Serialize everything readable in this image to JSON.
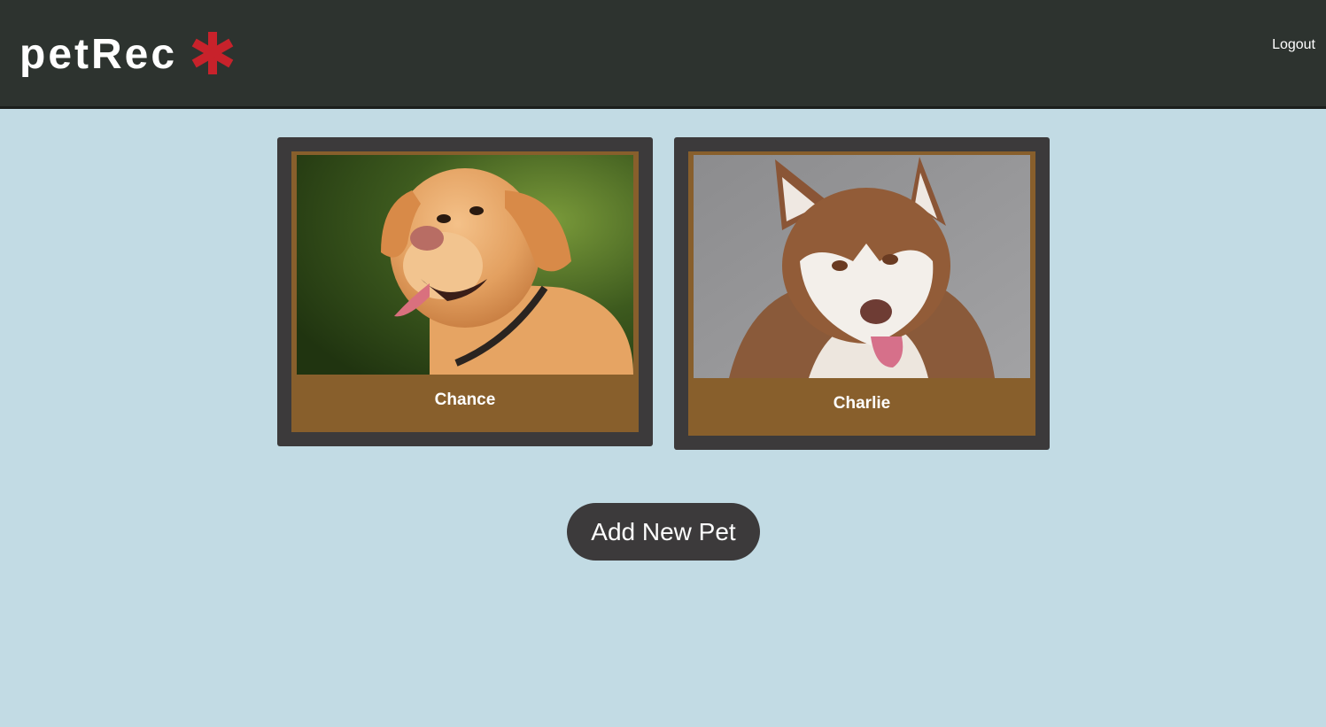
{
  "header": {
    "brand": "petRec",
    "brand_icon": "asterisk-icon",
    "logout_label": "Logout"
  },
  "pets": [
    {
      "name": "Chance",
      "photo": "golden-retriever-photo"
    },
    {
      "name": "Charlie",
      "photo": "husky-photo"
    }
  ],
  "actions": {
    "add_label": "Add New Pet"
  },
  "colors": {
    "header_bg": "#2d332f",
    "page_bg": "#c2dbe4",
    "card_frame": "#3c3a3b",
    "card_inner": "#885f2c",
    "brand_icon": "#c8222b"
  }
}
